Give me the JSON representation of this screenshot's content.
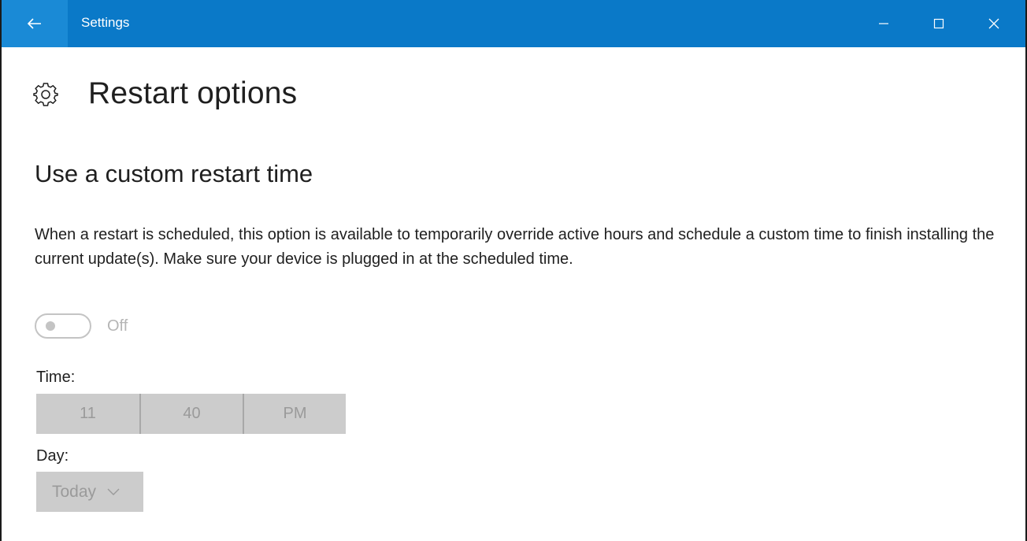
{
  "window": {
    "title": "Settings",
    "accent_color": "#0a79c8",
    "back_icon": "arrow-left-icon",
    "controls": [
      "minimize-icon",
      "maximize-icon",
      "close-icon"
    ]
  },
  "page": {
    "icon": "gear-icon",
    "title": "Restart options"
  },
  "section": {
    "title": "Use a custom restart time",
    "description": "When a restart is scheduled, this option is available to temporarily override active hours and schedule a custom time to finish installing the current update(s). Make sure your device is plugged in at the scheduled time."
  },
  "toggle": {
    "state": "Off",
    "enabled": false
  },
  "time": {
    "label": "Time:",
    "hour": "11",
    "minute": "40",
    "period": "PM"
  },
  "day": {
    "label": "Day:",
    "value": "Today",
    "icon": "chevron-down-icon"
  }
}
